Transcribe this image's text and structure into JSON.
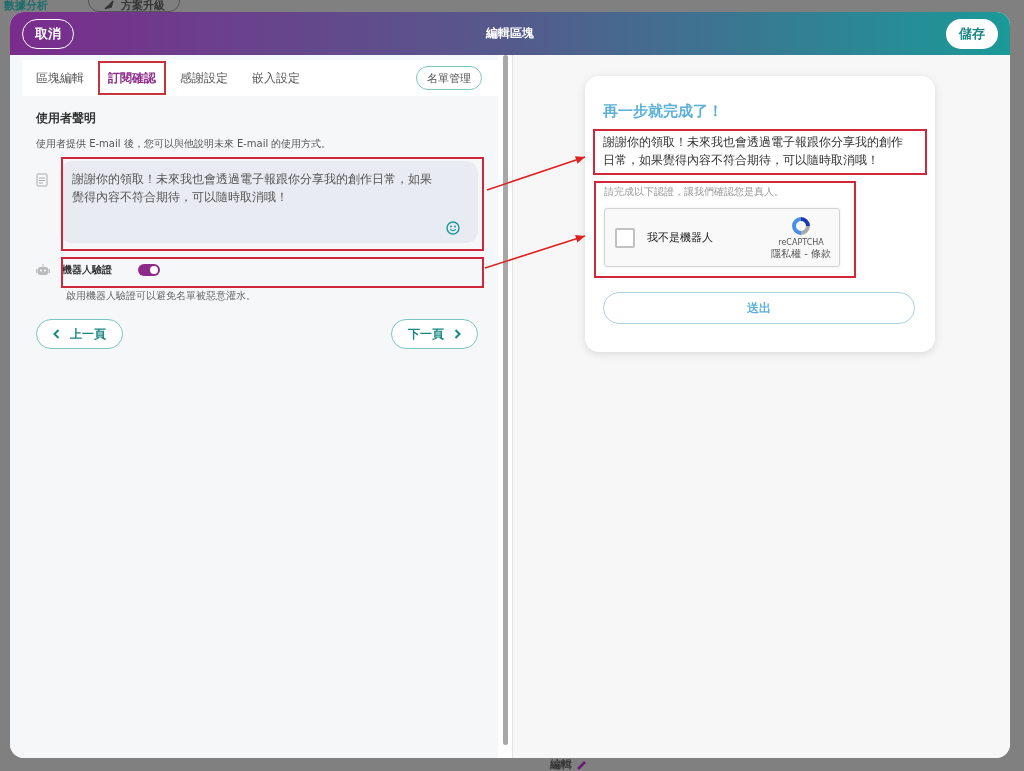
{
  "backdrop": {
    "top_link": "數據分析",
    "upgrade_button": "方案升級",
    "bottom_link": "編輯"
  },
  "dialog": {
    "cancel": "取消",
    "title": "編輯區塊",
    "save": "儲存"
  },
  "tabs": [
    {
      "label": "區塊編輯",
      "selected": false
    },
    {
      "label": "訂閱確認",
      "selected": true
    },
    {
      "label": "感謝設定",
      "selected": false
    },
    {
      "label": "嵌入設定",
      "selected": false
    }
  ],
  "list_button": "名單管理",
  "section": {
    "title": "使用者聲明",
    "description": "使用者提供 E-mail 後，您可以與他說明未來 E-mail 的使用方式。",
    "message": "謝謝你的領取！未來我也會透過電子報跟你分享我的創作日常，如果覺得內容不符合期待，可以隨時取消哦！"
  },
  "robot_check": {
    "label": "機器人驗證",
    "on": true,
    "hint": "啟用機器人驗證可以避免名單被惡意灌水。"
  },
  "nav": {
    "prev": "上一頁",
    "next": "下一頁"
  },
  "preview": {
    "title": "再一步就完成了！",
    "message": "謝謝你的領取！未來我也會透過電子報跟你分享我的創作日常，如果覺得內容不符合期待，可以隨時取消哦！",
    "captcha_hint": "請完成以下認證，讓我們確認您是真人。",
    "captcha": {
      "label": "我不是機器人",
      "checked": false,
      "brand": "reCAPTCHA",
      "links": "隱私權 - 條款"
    },
    "submit": "送出"
  }
}
